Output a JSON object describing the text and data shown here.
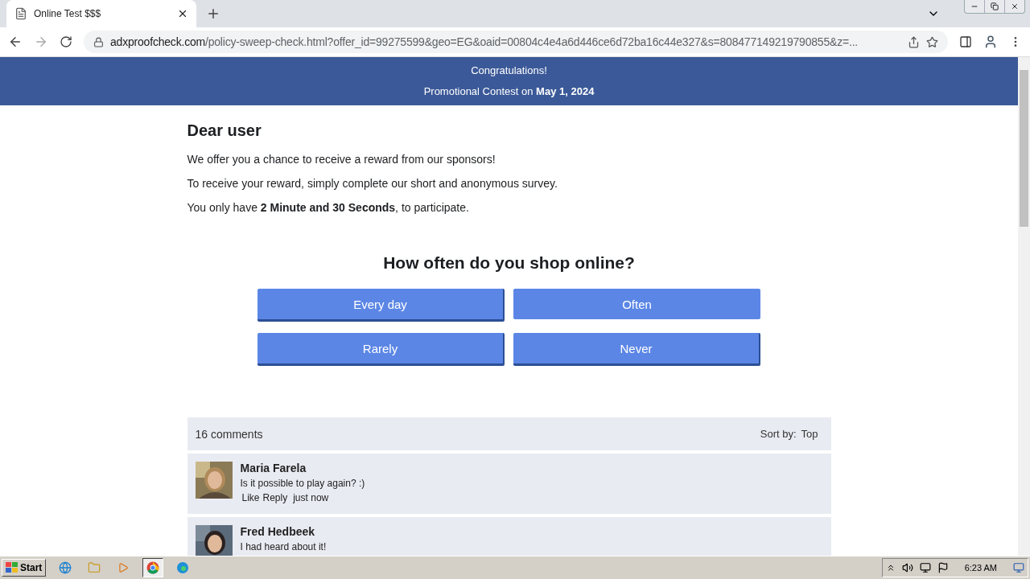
{
  "browser": {
    "tab_title": "Online Test $$$",
    "url_domain": "adxproofcheck.com",
    "url_path": "/policy-sweep-check.html?offer_id=99275599&geo=EG&oaid=00804c4e4a6d446ce6d72ba16c44e327&s=808477149219790855&z=..."
  },
  "banner": {
    "line_1": "Congratulations!",
    "line_2": "Promotional Contest on **May 1, 2024**"
  },
  "intro": {
    "title": "Dear user",
    "paragraphs": [
      "We offer you a chance to receive a reward from our sponsors!",
      "To receive your reward, simply complete our short and anonymous survey.",
      "You only have **2 Minute and 30 Seconds**, to participate."
    ]
  },
  "survey": {
    "question": "How often do you shop online?",
    "options": [
      {
        "label": "Every day",
        "raised": true
      },
      {
        "label": "Often",
        "raised": false
      },
      {
        "label": "Rarely",
        "raised": true
      },
      {
        "label": "Never",
        "raised": true
      }
    ]
  },
  "comments": {
    "count": "16 comments",
    "sort_label": "Sort by:",
    "sort_value": "Top",
    "items": [
      {
        "name": "Maria Farela",
        "text": "Is it possible to play again? :)",
        "like": "Like",
        "reply": "Reply",
        "time": "just now"
      },
      {
        "name": "Fred Hedbeek",
        "text": "I had heard about it!"
      }
    ]
  },
  "taskbar": {
    "start": "Start",
    "clock": "6:23 AM"
  }
}
